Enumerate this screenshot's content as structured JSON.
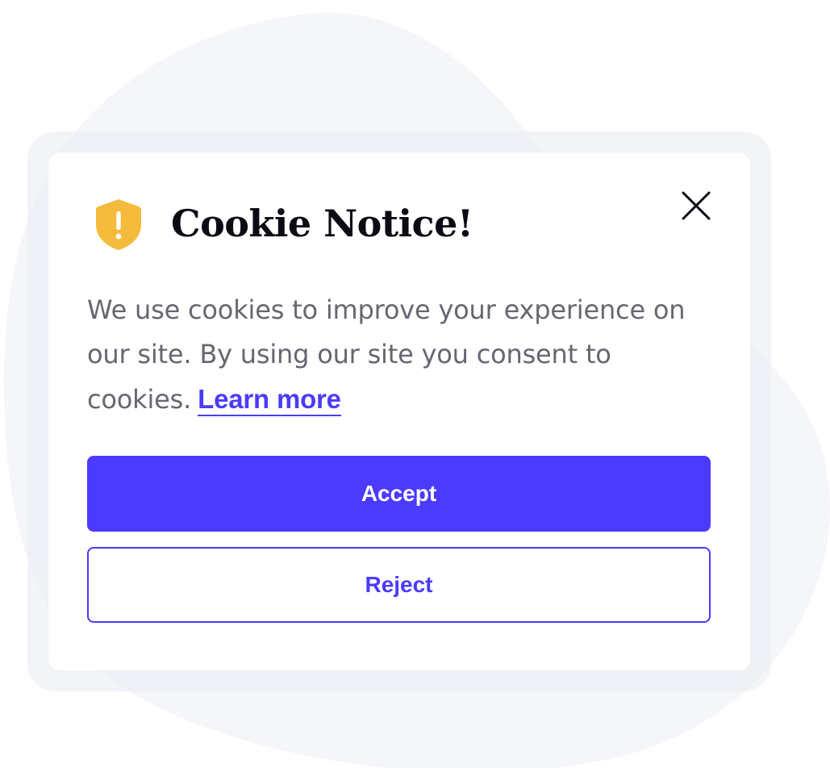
{
  "dialog": {
    "title": "Cookie Notice!",
    "message": "We use cookies to improve your experience on our site. By using our site you consent to cookies.",
    "learn_more_label": "Learn more",
    "accept_label": "Accept",
    "reject_label": "Reject",
    "icons": {
      "warning": "shield-warning-icon",
      "close": "close-icon"
    }
  },
  "colors": {
    "accent": "#4b3aff",
    "warning": "#f5bb3d",
    "title": "#0b0b14",
    "body_text": "#666770",
    "background_blob": "#f5f6f9"
  }
}
